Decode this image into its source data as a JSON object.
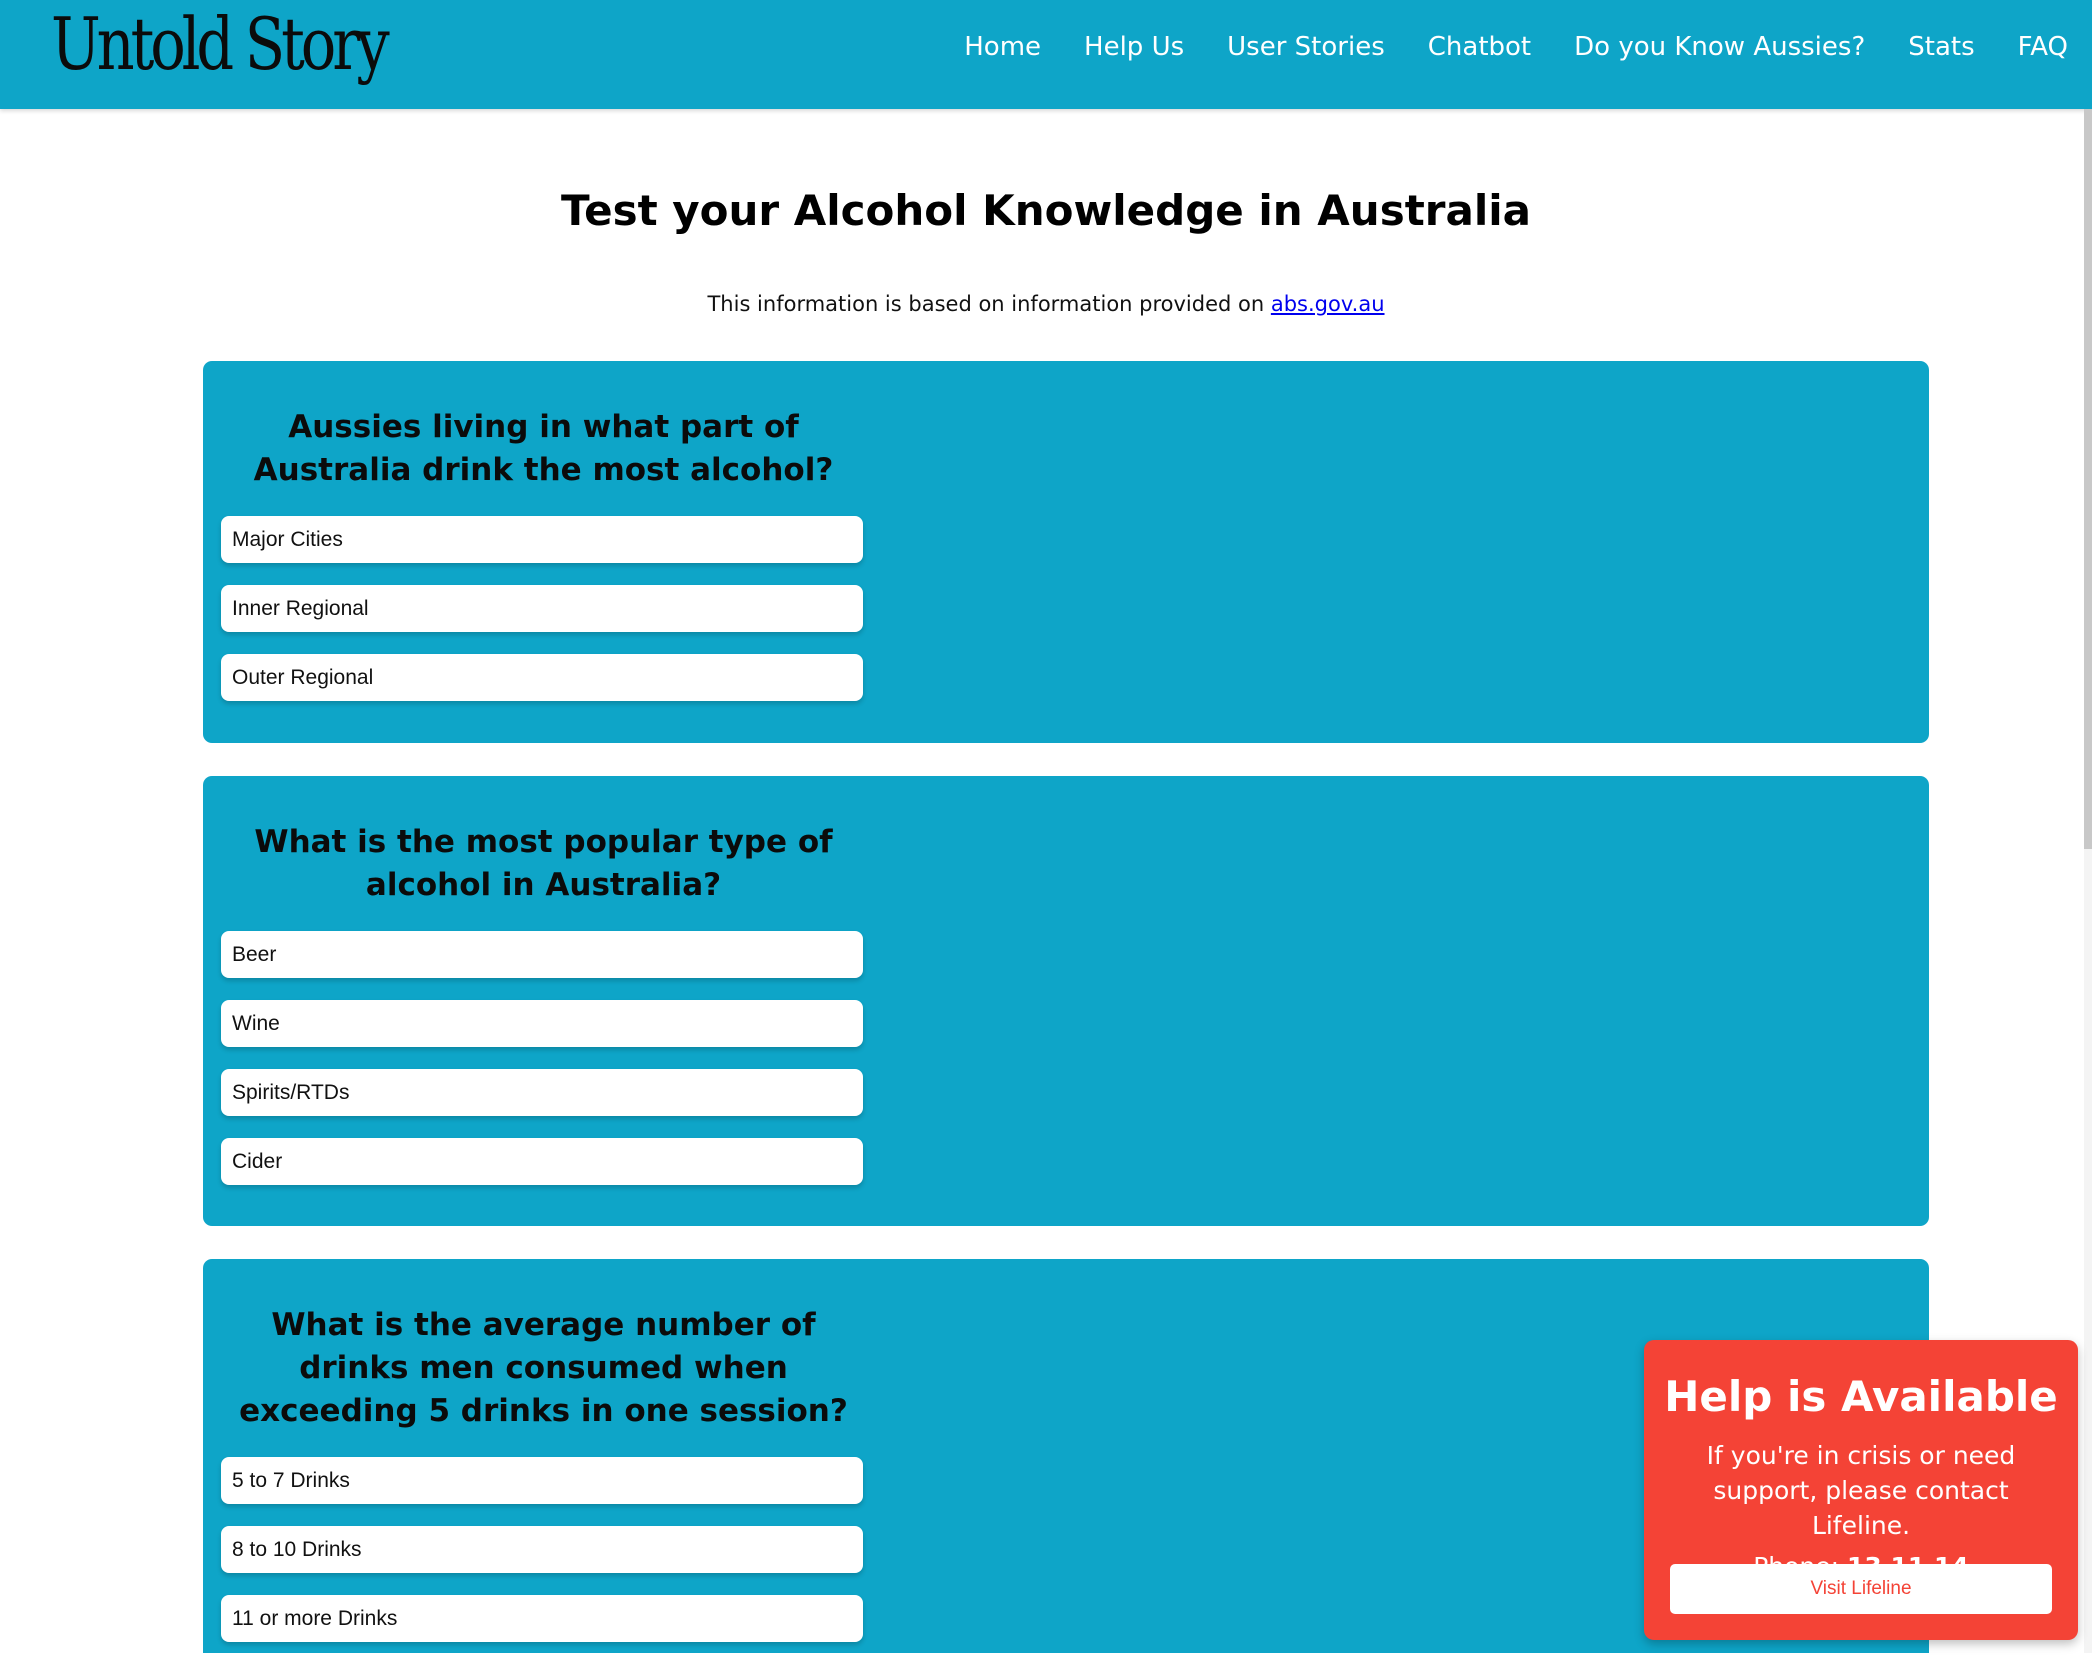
{
  "nav": {
    "logo": "Untold Story",
    "links": [
      "Home",
      "Help Us",
      "User Stories",
      "Chatbot",
      "Do you Know Aussies?",
      "Stats",
      "FAQ"
    ]
  },
  "page": {
    "title": "Test your Alcohol Knowledge in Australia",
    "source_prefix": "This information is based on information provided on ",
    "source_link": "abs.gov.au"
  },
  "quiz": [
    {
      "question": "Aussies living in what part of Australia drink the most alcohol?",
      "options": [
        "Major Cities",
        "Inner Regional",
        "Outer Regional"
      ]
    },
    {
      "question": "What is the most popular type of alcohol in Australia?",
      "options": [
        "Beer",
        "Wine",
        "Spirits/RTDs",
        "Cider"
      ]
    },
    {
      "question": "What is the average number of drinks men consumed when exceeding 5 drinks in one session?",
      "options": [
        "5 to 7 Drinks",
        "8 to 10 Drinks",
        "11 or more Drinks"
      ]
    }
  ],
  "help": {
    "title": "Help is Available",
    "text": "If you're in crisis or need support, please contact Lifeline.",
    "phone_label": "Phone: ",
    "phone_number": "13 11 14",
    "button": "Visit Lifeline"
  },
  "colors": {
    "accent": "#0ea5c8",
    "help_bg": "#f44336",
    "link": "#0000ee"
  }
}
